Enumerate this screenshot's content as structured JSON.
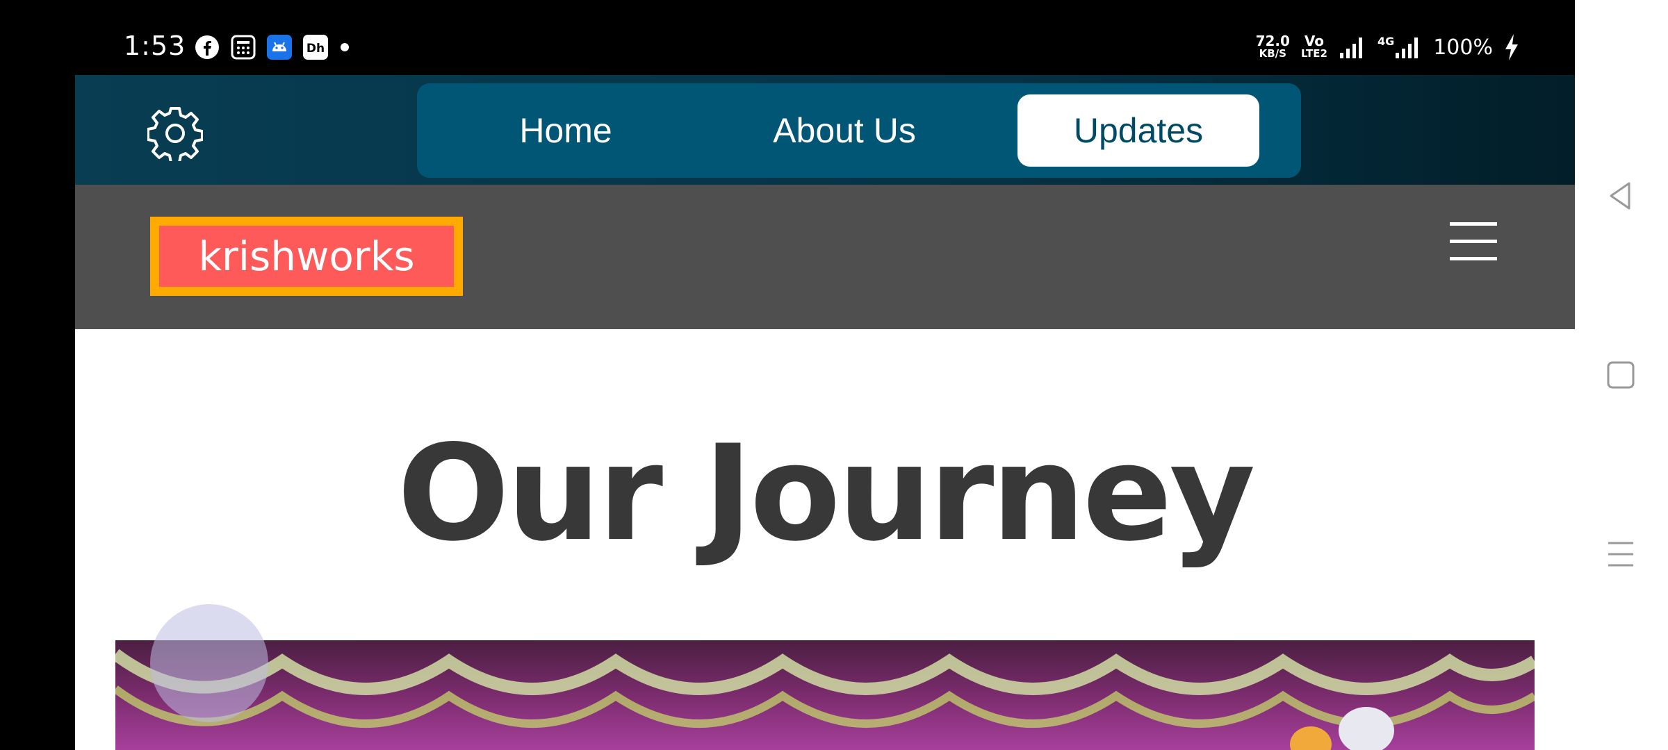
{
  "status_bar": {
    "time": "1:53",
    "notification_icons": [
      "facebook-icon",
      "calculator-icon",
      "android-icon",
      "dailyhunt-icon",
      "dot-icon"
    ],
    "network_speed": "72.0",
    "network_speed_unit": "KB/S",
    "volte_label": "Vo",
    "volte_sub": "LTE2",
    "signal_label": "4G",
    "battery": "100%"
  },
  "app_bar": {
    "tabs": [
      {
        "label": "Home",
        "active": false
      },
      {
        "label": "About Us",
        "active": false
      },
      {
        "label": "Updates",
        "active": true
      }
    ]
  },
  "header": {
    "logo_text": "krishworks"
  },
  "main": {
    "heading": "Our Journey"
  },
  "colors": {
    "app_bar": "#053346",
    "tab_bar": "#005674",
    "logo_bg": "#ff5a5a",
    "logo_border": "#ffaa00",
    "header_bg": "#4f4f4f",
    "heading": "#383838"
  }
}
